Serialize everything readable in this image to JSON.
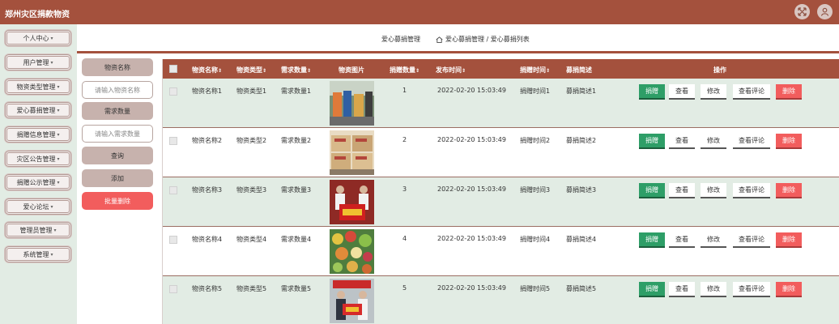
{
  "header": {
    "title": "郑州灾区捐款物资",
    "icons": [
      "fullscreen-icon",
      "user-icon"
    ]
  },
  "sidebar": {
    "items": [
      {
        "label": "个人中心"
      },
      {
        "label": "用户管理"
      },
      {
        "label": "物资类型管理"
      },
      {
        "label": "爱心募捐管理"
      },
      {
        "label": "捐赠信息管理"
      },
      {
        "label": "灾区公告管理"
      },
      {
        "label": "捐赠公示管理"
      },
      {
        "label": "爱心论坛"
      },
      {
        "label": "管理员管理"
      },
      {
        "label": "系统管理"
      }
    ],
    "caret": "▾"
  },
  "breadcrumb": {
    "section": "爱心募捐管理",
    "path": "爱心募捐管理 / 爱心募捐列表"
  },
  "filters": {
    "name_label": "物资名称",
    "name_placeholder": "请输入物资名称",
    "qty_label": "需求数量",
    "qty_placeholder": "请输入需求数量",
    "query_button": "查询",
    "add_button": "添加",
    "batch_delete_button": "批量删除"
  },
  "table": {
    "headers": [
      "物资名称",
      "物资类型",
      "需求数量",
      "物资图片",
      "捐赠数量",
      "发布时间",
      "捐赠时间",
      "募捐简述",
      "操作"
    ],
    "sort_glyph": "⇕",
    "actions": {
      "donate": "捐赠",
      "view": "查看",
      "edit": "修改",
      "view_comments": "查看评论",
      "delete": "删除"
    },
    "rows": [
      {
        "name": "物资名称1",
        "type": "物资类型1",
        "demand": "需求数量1",
        "donated": "1",
        "published": "2022-02-20 15:03:49",
        "donate_time": "捐赠时间1",
        "summary": "募捐简述1"
      },
      {
        "name": "物资名称2",
        "type": "物资类型2",
        "demand": "需求数量2",
        "donated": "2",
        "published": "2022-02-20 15:03:49",
        "donate_time": "捐赠时间2",
        "summary": "募捐简述2"
      },
      {
        "name": "物资名称3",
        "type": "物资类型3",
        "demand": "需求数量3",
        "donated": "3",
        "published": "2022-02-20 15:03:49",
        "donate_time": "捐赠时间3",
        "summary": "募捐简述3"
      },
      {
        "name": "物资名称4",
        "type": "物资类型4",
        "demand": "需求数量4",
        "donated": "4",
        "published": "2022-02-20 15:03:49",
        "donate_time": "捐赠时间4",
        "summary": "募捐简述4"
      },
      {
        "name": "物资名称5",
        "type": "物资类型5",
        "demand": "需求数量5",
        "donated": "5",
        "published": "2022-02-20 15:03:49",
        "donate_time": "捐赠时间5",
        "summary": "募捐简述5"
      }
    ]
  },
  "colors": {
    "brand": "#a4513d",
    "accent_bg": "#e2ece4",
    "donate": "#2e9e67",
    "danger": "#f25d5d"
  }
}
